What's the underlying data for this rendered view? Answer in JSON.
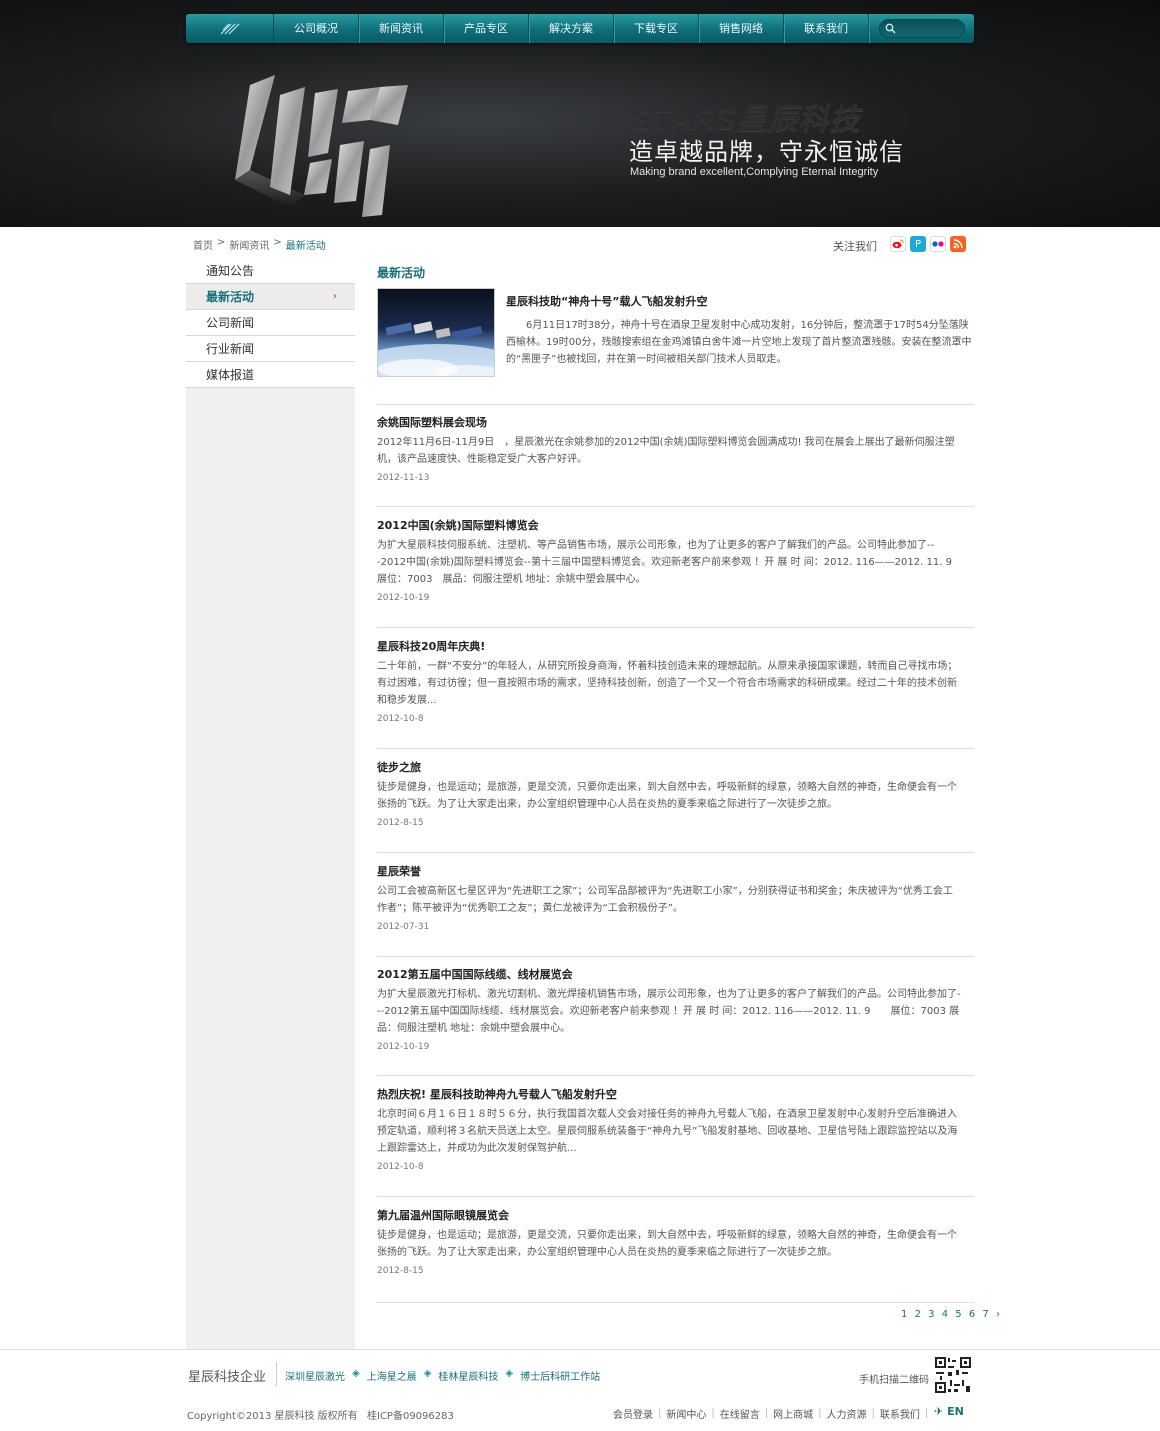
{
  "nav": {
    "items": [
      "公司概况",
      "新闻资讯",
      "产品专区",
      "解决方案",
      "下载专区",
      "销售网络",
      "联系我们"
    ]
  },
  "banner": {
    "logo_text": "STARS星辰科技",
    "slogan_cn": "造卓越品牌，守永恒诚信",
    "slogan_en": "Making brand excellent,Complying Eternal Integrity"
  },
  "breadcrumb": {
    "home": "首页",
    "sep": ">",
    "news": "新闻资讯",
    "current": "最新活动"
  },
  "follow": {
    "label": "关注我们",
    "icons": [
      "weibo-icon",
      "tencent-weibo-icon",
      "flickr-icon",
      "rss-icon"
    ]
  },
  "sidebar": {
    "items": [
      {
        "label": "通知公告",
        "active": false
      },
      {
        "label": "最新活动",
        "active": true
      },
      {
        "label": "公司新闻",
        "active": false
      },
      {
        "label": "行业新闻",
        "active": false
      },
      {
        "label": "媒体报道",
        "active": false
      }
    ]
  },
  "main": {
    "section_title": "最新活动",
    "feature": {
      "title": "星辰科技助“神舟十号”载人飞船发射升空",
      "text": "6月11日17时38分，神舟十号在酒泉卫星发射中心成功发射，16分钟后，整流罩于17时54分坠落陕西榆林。19时00分，残骸搜索组在金鸡滩镇白舍牛滩一片空地上发现了首片整流罩残骸。安装在整流罩中的“黑匣子”也被找回，并在第一时间被相关部门技术人员取走。"
    },
    "news": [
      {
        "title": "余姚国际塑料展会现场",
        "text": "2012年11月6日-11月9日　，星辰激光在余姚参加的2012中国(余姚)国际塑料博览会圆满成功! 我司在展会上展出了最新伺服注塑机，该产品速度快、性能稳定受广大客户好评。",
        "date": "2012-11-13"
      },
      {
        "title": "2012中国(余姚)国际塑料博览会",
        "text": "为扩大星辰科技伺服系统、注塑机、等产品销售市场，展示公司形象，也为了让更多的客户了解我们的产品。公司特此参加了---2012中国(余姚)国际塑料博览会--第十三届中国塑料博览会。欢迎新老客户前来参观 ！开 展 时 间：2012. 116——2012. 11. 9　　展位：7003　展品：伺服注塑机 地址：余姚中塑会展中心。",
        "date": "2012-10-19"
      },
      {
        "title": "星辰科技20周年庆典!",
        "text": "二十年前，一群“不安分”的年轻人，从研究所投身商海，怀着科技创造未来的理想起航。从原来承接国家课题，转而自己寻找市场；有过困难，有过彷徨；但一直按照市场的需求，坚持科技创新，创造了一个又一个符合市场需求的科研成果。经过二十年的技术创新和稳步发展...",
        "date": "2012-10-8"
      },
      {
        "title": "徒步之旅",
        "text": "徒步是健身，也是运动；是旅游，更是交流，只要你走出来，到大自然中去，呼吸新鲜的绿意，领略大自然的神奇，生命便会有一个张扬的飞跃。为了让大家走出来，办公室组织管理中心人员在炎热的夏季来临之际进行了一次徒步之旅。",
        "date": "2012-8-15"
      },
      {
        "title": "星辰荣誉",
        "text": "公司工会被高新区七星区评为“先进职工之家”；公司军品部被评为“先进职工小家”，分别获得证书和奖金；朱庆被评为“优秀工会工作者”；陈平被评为“优秀职工之友”；黄仁龙被评为“工会积极份子”。",
        "date": "2012-07-31"
      },
      {
        "title": "2012第五届中国国际线缆、线材展览会",
        "text": "为扩大星辰激光打标机、激光切割机、激光焊接机销售市场，展示公司形象，也为了让更多的客户了解我们的产品。公司特此参加了---2012第五届中国国际线缆、线材展览会。欢迎新老客户前来参观 ！开 展 时 间：2012. 116——2012. 11. 9　　展位：7003 展品：伺服注塑机 地址：余姚中塑会展中心。",
        "date": "2012-10-19"
      },
      {
        "title": "热烈庆祝! 星辰科技助神舟九号载人飞船发射升空",
        "text": "北京时间６月１６日１８时５６分，执行我国首次载人交会对接任务的神舟九号载人飞船，在酒泉卫星发射中心发射升空后准确进入预定轨道，顺利将３名航天员送上太空。星辰伺服系统装备于“神舟九号”飞船发射基地、回收基地、卫星信号陆上跟踪监控站以及海上跟踪雷达上，并成功为此次发射保驾护航...",
        "date": "2012-10-8"
      },
      {
        "title": "第九届温州国际眼镜展览会",
        "text": "徒步是健身，也是运动；是旅游，更是交流，只要你走出来，到大自然中去，呼吸新鲜的绿意，领略大自然的神奇，生命便会有一个张扬的飞跃。为了让大家走出来，办公室组织管理中心人员在炎热的夏季来临之际进行了一次徒步之旅。",
        "date": "2012-8-15"
      }
    ],
    "pagination": [
      "1",
      "2",
      "3",
      "4",
      "5",
      "6",
      "7"
    ]
  },
  "footer": {
    "brand": "星辰科技企业",
    "links": [
      "深圳星辰激光",
      "上海星之晨",
      "桂林星辰科技",
      "博士后科研工作站"
    ],
    "qr_label": "手机扫描二维码",
    "copyright": "Copyright©2013  星辰科技  版权所有",
    "icp": "桂ICP备09096283",
    "bottom_links": [
      "会员登录",
      "新闻中心",
      "在线留言",
      "网上商城",
      "人力资源",
      "联系我们"
    ],
    "lang": "EN"
  },
  "colors": {
    "accent": "#1a6f78",
    "nav_top": "#2a9aa3",
    "nav_bottom": "#0b5a63",
    "highlight_arrow": "#c06a1f"
  }
}
